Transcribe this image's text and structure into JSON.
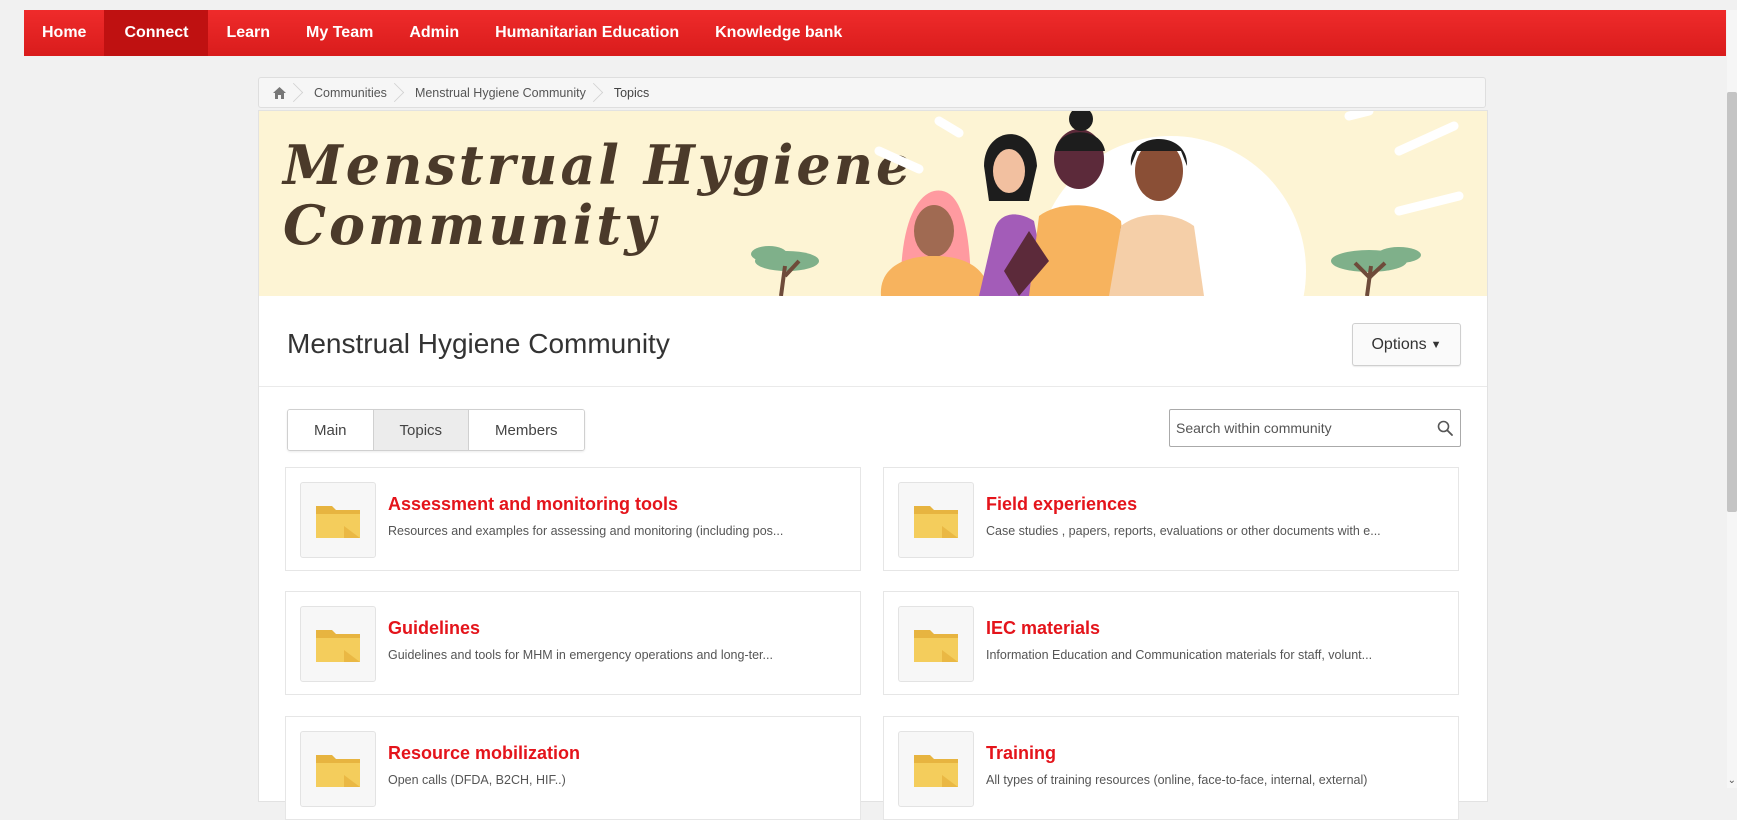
{
  "nav": {
    "items": [
      {
        "label": "Home"
      },
      {
        "label": "Connect",
        "active": true
      },
      {
        "label": "Learn"
      },
      {
        "label": "My Team"
      },
      {
        "label": "Admin"
      },
      {
        "label": "Humanitarian Education"
      },
      {
        "label": "Knowledge bank"
      }
    ]
  },
  "breadcrumb": {
    "home_icon": "home-icon",
    "items": [
      "Communities",
      "Menstrual Hygiene Community",
      "Topics"
    ]
  },
  "banner": {
    "title_line1": "Menstrual Hygiene",
    "title_line2": "Community"
  },
  "header": {
    "title": "Menstrual Hygiene Community",
    "options_label": "Options"
  },
  "tabs": [
    {
      "label": "Main"
    },
    {
      "label": "Topics",
      "active": true
    },
    {
      "label": "Members"
    }
  ],
  "search": {
    "placeholder": "Search within community",
    "icon": "search-icon"
  },
  "topics": [
    {
      "title": "Assessment and monitoring tools",
      "description": "Resources and examples for assessing and monitoring (including pos..."
    },
    {
      "title": "Field experiences",
      "description": "Case studies , papers, reports, evaluations or other documents with e..."
    },
    {
      "title": "Guidelines",
      "description": "Guidelines and tools for MHM in emergency operations and long-ter..."
    },
    {
      "title": "IEC materials",
      "description": "Information Education and Communication materials for staff, volunt..."
    },
    {
      "title": "Resource mobilization",
      "description": "Open calls (DFDA, B2CH, HIF..)"
    },
    {
      "title": "Training",
      "description": "All types of training resources (online, face-to-face, internal, external)"
    }
  ],
  "colors": {
    "nav_red": "#e32222",
    "nav_active": "#bf1111",
    "topic_title": "#e4141b",
    "folder": "#f2c94c",
    "banner_bg": "#fdf4d4"
  }
}
